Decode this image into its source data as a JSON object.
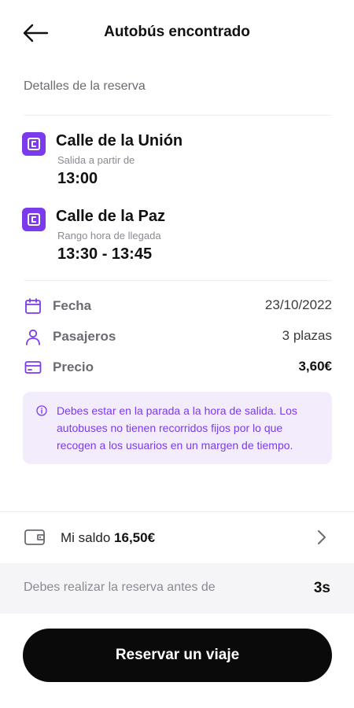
{
  "header": {
    "title": "Autobús encontrado",
    "back_icon": "arrow-left-icon"
  },
  "section_label": "Detalles de la reserva",
  "origin": {
    "icon": "bus-stop-icon",
    "name": "Calle de la Unión",
    "sub": "Salida a partir de",
    "time": "13:00"
  },
  "destination": {
    "icon": "bus-stop-icon",
    "name": "Calle de la Paz",
    "sub": "Rango hora de llegada",
    "time": "13:30 - 13:45"
  },
  "details": {
    "date": {
      "icon": "calendar-icon",
      "label": "Fecha",
      "value": "23/10/2022"
    },
    "passengers": {
      "icon": "user-icon",
      "label": "Pasajeros",
      "value": "3 plazas"
    },
    "price": {
      "icon": "card-icon",
      "label": "Precio",
      "value": "3,60€"
    }
  },
  "notice": {
    "icon": "info-icon",
    "text": "Debes estar en la parada a la hora de salida. Los autobuses no tienen recorridos fijos por lo que recogen a los usuarios en un margen de tiempo."
  },
  "wallet": {
    "icon": "wallet-icon",
    "label": "Mi saldo",
    "amount": "16,50€",
    "chevron": "chevron-right-icon"
  },
  "deadline": {
    "text": "Debes realizar la reserva antes de",
    "countdown": "3s"
  },
  "cta": {
    "label": "Reservar un viaje"
  },
  "colors": {
    "accent": "#7c3aed",
    "notice_bg": "#f3ecfd",
    "button": "#0a0a0a"
  }
}
